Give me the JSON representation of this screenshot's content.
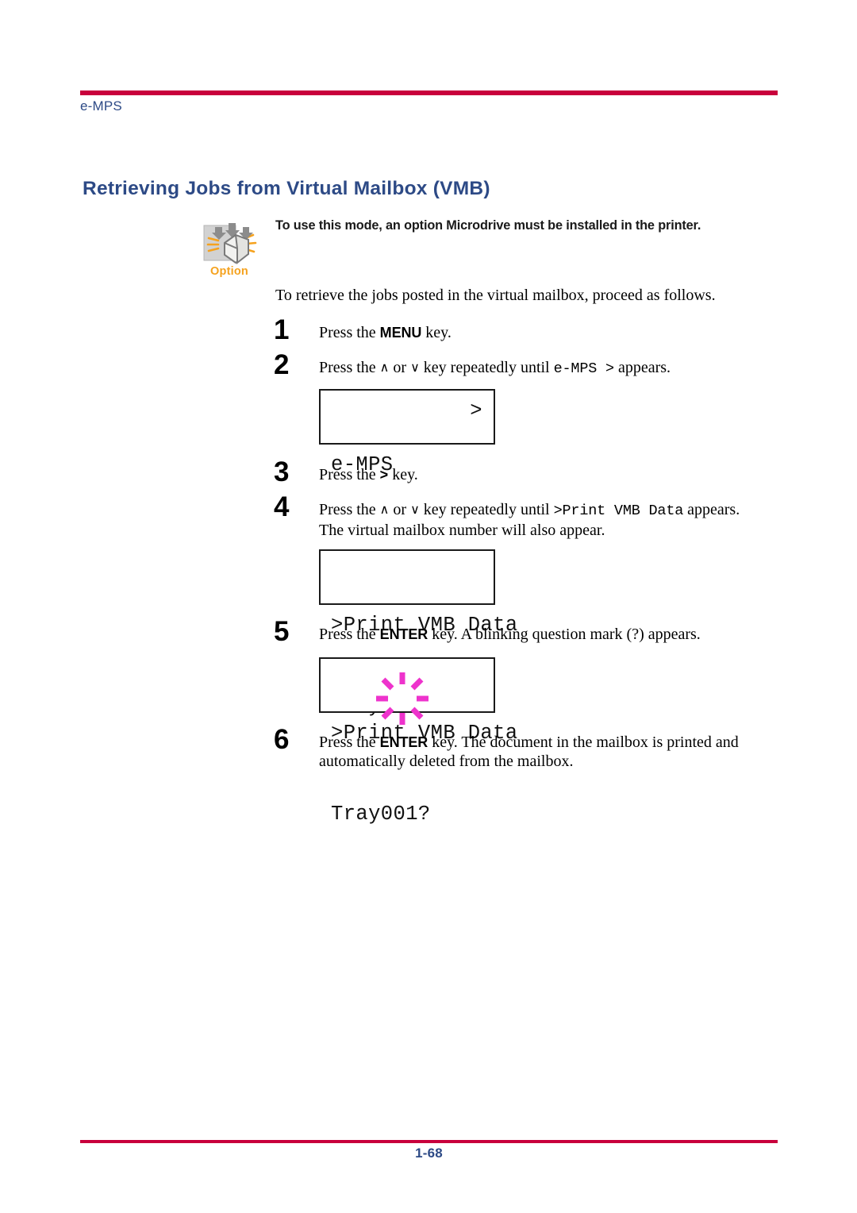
{
  "header": {
    "label": "e-MPS",
    "rule_color": "#c8003c",
    "text_color": "#2d4a86"
  },
  "title": "Retrieving Jobs from Virtual Mailbox (VMB)",
  "option_callout": {
    "icon_name": "option-box-icon",
    "caption": "Option",
    "caption_color": "#f5a21e",
    "notice": "To use this mode, an option Microdrive must be installed in the printer."
  },
  "intro": "To retrieve the jobs posted in the virtual mailbox, proceed as follows.",
  "steps": [
    {
      "number": "1",
      "parts": {
        "pre": "Press the ",
        "key": "MENU",
        "post": " key."
      }
    },
    {
      "number": "2",
      "parts": {
        "pre": "Press the ",
        "up": "∧",
        "mid": " or ",
        "down": "∨",
        "post": " key repeatedly until ",
        "mono": "e-MPS  >",
        "tail": " appears."
      }
    },
    {
      "number": "3",
      "parts": {
        "pre": "Press the ",
        "key": ">",
        "post": " key."
      }
    },
    {
      "number": "4",
      "parts": {
        "pre": "Press the ",
        "up": "∧",
        "mid": " or ",
        "down": "∨",
        "post": " key repeatedly until ",
        "mono": ">Print VMB Data",
        "tail": " appears.",
        "line2": "The virtual mailbox number will also appear."
      }
    },
    {
      "number": "5",
      "parts": {
        "pre": "Press the ",
        "key": "ENTER",
        "post": " key. A blinking question mark (?) appears."
      }
    },
    {
      "number": "6",
      "parts": {
        "pre": "Press the ",
        "key": "ENTER",
        "post": " key. The document in the mailbox is printed and",
        "line2": "automatically deleted from the mailbox."
      }
    }
  ],
  "lcd_panels": [
    {
      "name": "lcd-emps",
      "line1_left": "e-MPS",
      "line1_right": ">",
      "line2": ""
    },
    {
      "name": "lcd-print-vmb-data",
      "line1_left": ">Print VMB Data",
      "line1_right": "",
      "line2": "Tray001:"
    },
    {
      "name": "lcd-print-vmb-data-confirm",
      "line1_left": ">Print VMB Data",
      "line1_right": "",
      "line2": "Tray001?"
    }
  ],
  "blink_indicator": {
    "name": "blinking-question-mark-indicator",
    "color": "#ee33cc"
  },
  "footer": {
    "page_number": "1-68",
    "rule_color": "#c8003c",
    "text_color": "#2d4a86"
  }
}
